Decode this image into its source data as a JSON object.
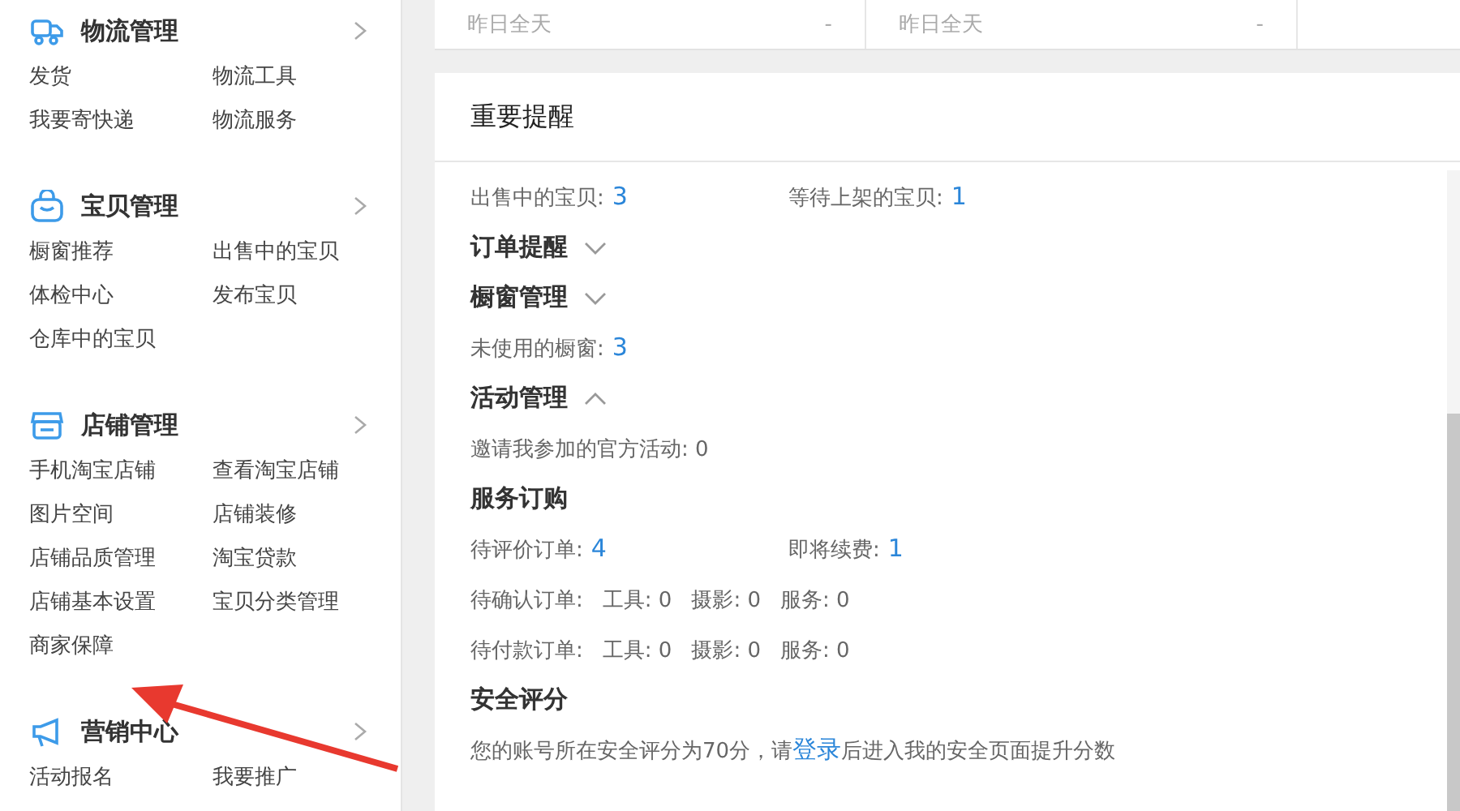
{
  "sidebar": {
    "sections": [
      {
        "title": "物流管理",
        "items": [
          "发货",
          "物流工具",
          "我要寄快递",
          "物流服务"
        ]
      },
      {
        "title": "宝贝管理",
        "items": [
          "橱窗推荐",
          "出售中的宝贝",
          "体检中心",
          "发布宝贝",
          "仓库中的宝贝"
        ]
      },
      {
        "title": "店铺管理",
        "items": [
          "手机淘宝店铺",
          "查看淘宝店铺",
          "图片空间",
          "店铺装修",
          "店铺品质管理",
          "淘宝贷款",
          "店铺基本设置",
          "宝贝分类管理",
          "商家保障"
        ]
      },
      {
        "title": "营销中心",
        "items": [
          "活动报名",
          "我要推广"
        ]
      }
    ]
  },
  "summary": [
    {
      "label": "昨日全天",
      "value": "-"
    },
    {
      "label": "昨日全天",
      "value": "-"
    }
  ],
  "reminders": {
    "title": "重要提醒",
    "rows": [
      {
        "kind": "stats",
        "items": [
          {
            "label": "出售中的宝贝:",
            "value": "3"
          },
          {
            "label": "等待上架的宝贝:",
            "value": "1"
          }
        ]
      },
      {
        "kind": "heading",
        "text": "订单提醒",
        "expanded": false
      },
      {
        "kind": "heading",
        "text": "橱窗管理",
        "expanded": false
      },
      {
        "kind": "stats",
        "items": [
          {
            "label": "未使用的橱窗:",
            "value": "3"
          }
        ]
      },
      {
        "kind": "heading",
        "text": "活动管理",
        "expanded": true
      },
      {
        "kind": "line",
        "text": "邀请我参加的官方活动: 0"
      },
      {
        "kind": "heading",
        "text": "服务订购"
      },
      {
        "kind": "stats",
        "items": [
          {
            "label": "待评价订单:",
            "value": "4"
          },
          {
            "label": "即将续费:",
            "value": "1"
          }
        ]
      },
      {
        "kind": "counts",
        "label": "待确认订单:",
        "items": [
          "工具: 0",
          "摄影: 0",
          "服务: 0"
        ]
      },
      {
        "kind": "counts",
        "label": "待付款订单:",
        "items": [
          "工具: 0",
          "摄影: 0",
          "服务: 0"
        ]
      },
      {
        "kind": "heading",
        "text": "安全评分"
      },
      {
        "kind": "notice",
        "text": "您的账号所在安全评分为70分，请",
        "link": "登录",
        "after": "后进入我的安全页面提升分数"
      }
    ]
  }
}
